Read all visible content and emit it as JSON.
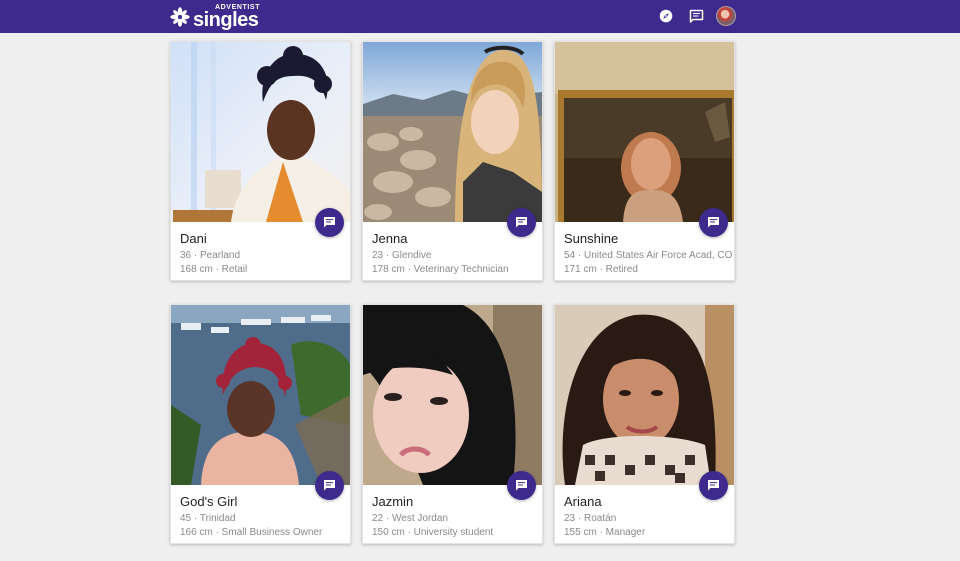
{
  "brand": {
    "small": "ADVENTIST",
    "big": "singles",
    "color": "#3d2a8c"
  },
  "nav": {
    "icons": [
      "compass-icon",
      "messages-icon"
    ]
  },
  "profiles": [
    {
      "name": "Dani",
      "line1": "36 · Pearland",
      "line2": "168 cm · Retail"
    },
    {
      "name": "Jenna",
      "line1": "23 · Glendive",
      "line2": "178 cm · Veterinary Technician"
    },
    {
      "name": "Sunshine",
      "line1": "54 · United States Air Force Acad, CO",
      "line2": "171 cm · Retired"
    },
    {
      "name": "God's Girl",
      "line1": "45 · Trinidad",
      "line2": "166 cm · Small Business Owner"
    },
    {
      "name": "Jazmin",
      "line1": "22 · West Jordan",
      "line2": "150 cm · University student"
    },
    {
      "name": "Ariana",
      "line1": "23 · Roatán",
      "line2": "155 cm · Manager"
    }
  ]
}
